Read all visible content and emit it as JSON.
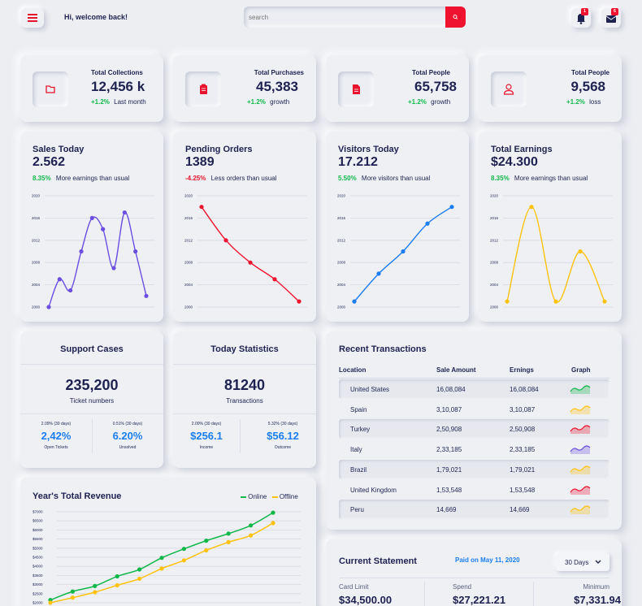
{
  "header": {
    "welcome": "Hi, welcome back!",
    "search_placeholder": "search",
    "notification_count": "1",
    "message_count": "6"
  },
  "stats": [
    {
      "title": "Total Collections",
      "value": "12,456 k",
      "change": "+1.2%",
      "note": "Last month",
      "icon": "folder-icon"
    },
    {
      "title": "Total Purchases",
      "value": "45,383",
      "change": "+1.2%",
      "note": "growth",
      "icon": "clipboard-icon"
    },
    {
      "title": "Total People",
      "value": "65,758",
      "change": "+1.2%",
      "note": "growth",
      "icon": "document-icon"
    },
    {
      "title": "Total People",
      "value": "9,568",
      "change": "+1.2%",
      "note": "loss",
      "icon": "user-icon"
    }
  ],
  "mini_charts": [
    {
      "title": "Sales Today",
      "value": "2.562",
      "change": "8.35%",
      "note": "More earnings than usual",
      "color": "#6c4fe0"
    },
    {
      "title": "Pending Orders",
      "value": "1389",
      "change": "-4.25%",
      "note": "Less orders than usual",
      "color": "#f0132f"
    },
    {
      "title": "Visitors Today",
      "value": "17.212",
      "change": "5.50%",
      "note": "More visitors than usual",
      "color": "#1b7ef0"
    },
    {
      "title": "Total Earnings",
      "value": "$24.300",
      "change": "8.35%",
      "note": "More earnings than usual",
      "color": "#ffc20e"
    }
  ],
  "support": {
    "title": "Support Cases",
    "value": "235,200",
    "label": "Ticket numbers",
    "left_change": "2.09% (30 days)",
    "left_value": "2,42%",
    "left_label": "Open Tickets",
    "right_change": "0.51% (30 days)",
    "right_value": "6.20%",
    "right_label": "Unsolved"
  },
  "today": {
    "title": "Today Statistics",
    "value": "81240",
    "label": "Transactions",
    "left_change": "2.00% (30 days)",
    "left_value": "$256.1",
    "left_label": "Income",
    "right_change": "5.32% (30 days)",
    "right_value": "$56.12",
    "right_label": "Outcome"
  },
  "transactions": {
    "title": "Recent Transactions",
    "columns": [
      "Location",
      "Sale Amount",
      "Ernings",
      "Graph"
    ],
    "rows": [
      {
        "location": "United States",
        "sale": "16,08,084",
        "earnings": "16,08,084",
        "graph_color": "#10b84a"
      },
      {
        "location": "Spain",
        "sale": "3,10,087",
        "earnings": "3,10,087",
        "graph_color": "#ffc20e"
      },
      {
        "location": "Turkey",
        "sale": "2,50,908",
        "earnings": "2,50,908",
        "graph_color": "#f0132f"
      },
      {
        "location": "Italy",
        "sale": "2,33,185",
        "earnings": "2,33,185",
        "graph_color": "#6c4fe0"
      },
      {
        "location": "Brazil",
        "sale": "1,79,021",
        "earnings": "1,79,021",
        "graph_color": "#ffc20e"
      },
      {
        "location": "United Kingdom",
        "sale": "1,53,548",
        "earnings": "1,53,548",
        "graph_color": "#f0132f"
      },
      {
        "location": "Peru",
        "sale": "14,669",
        "earnings": "14,669",
        "graph_color": "#ffc20e"
      }
    ]
  },
  "revenue": {
    "title": "Year's Total Revenue",
    "legend_online": "Online",
    "legend_offline": "Offline",
    "online_color": "#10b84a",
    "offline_color": "#ffc20e"
  },
  "statement": {
    "title": "Current Statement",
    "paid": "Paid on May 11, 2020",
    "dropdown": "30 Days",
    "card_limit_label": "Card Limit",
    "card_limit": "$34,500.00",
    "spend_label": "Spend",
    "spend": "$27,221.21",
    "minimum_label": "Minimum",
    "minimum": "$7,331.94"
  },
  "chart_data": [
    {
      "type": "line",
      "series_color": "#6c4fe0",
      "ylim": [
        2000,
        2020
      ],
      "y_ticks": [
        "2000",
        "2004",
        "2008",
        "2012",
        "2016",
        "2020"
      ],
      "values": [
        2000,
        2005,
        2003,
        2010,
        2016,
        2014,
        2007,
        2017,
        2010,
        2002
      ]
    },
    {
      "type": "line",
      "series_color": "#f0132f",
      "ylim": [
        2000,
        2020
      ],
      "y_ticks": [
        "2000",
        "2004",
        "2008",
        "2012",
        "2016",
        "2020"
      ],
      "values": [
        2018,
        2012,
        2008,
        2005,
        2001
      ]
    },
    {
      "type": "line",
      "series_color": "#1b7ef0",
      "ylim": [
        2000,
        2020
      ],
      "y_ticks": [
        "2000",
        "2004",
        "2008",
        "2012",
        "2016",
        "2020"
      ],
      "values": [
        2001,
        2006,
        2010,
        2015,
        2018
      ]
    },
    {
      "type": "line",
      "series_color": "#ffc20e",
      "ylim": [
        2000,
        2020
      ],
      "y_ticks": [
        "2000",
        "2004",
        "2008",
        "2012",
        "2016",
        "2020"
      ],
      "values": [
        2001,
        2018,
        2001,
        2010,
        2001
      ]
    },
    {
      "type": "line",
      "title": "Year's Total Revenue",
      "ylim": [
        2000,
        7000
      ],
      "y_ticks": [
        "$2000",
        "$2500",
        "$3000",
        "$3500",
        "$4000",
        "$4500",
        "$5000",
        "$5500",
        "$6000",
        "$6500",
        "$7000"
      ],
      "series": [
        {
          "name": "Online",
          "color": "#10b84a",
          "values": [
            2150,
            2620,
            2920,
            3450,
            3830,
            4470,
            4960,
            5410,
            5800,
            6250,
            6950
          ]
        },
        {
          "name": "Offline",
          "color": "#ffc20e",
          "values": [
            2000,
            2280,
            2580,
            2960,
            3320,
            3880,
            4330,
            4880,
            5330,
            5700,
            6380
          ]
        }
      ]
    }
  ]
}
